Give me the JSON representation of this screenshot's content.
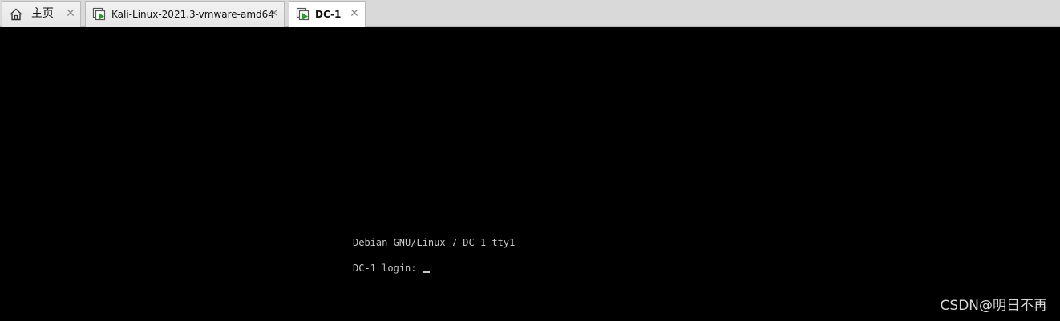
{
  "tabs": [
    {
      "label": "主页",
      "icon": "home-icon",
      "active": false
    },
    {
      "label": "Kali-Linux-2021.3-vmware-amd64",
      "icon": "vm-running-icon",
      "active": false
    },
    {
      "label": "DC-1",
      "icon": "vm-running-icon",
      "active": true
    }
  ],
  "console": {
    "banner": "Debian GNU/Linux 7 DC-1 tty1",
    "login_prompt": "DC-1 login: "
  },
  "watermark": "CSDN@明日不再",
  "colors": {
    "console_bg": "#000000",
    "console_text": "#c8c8c8",
    "vm_play_green": "#2e9a2e",
    "tabbar_bg": "#d9d9d9",
    "active_tab_bg": "#ffffff"
  }
}
